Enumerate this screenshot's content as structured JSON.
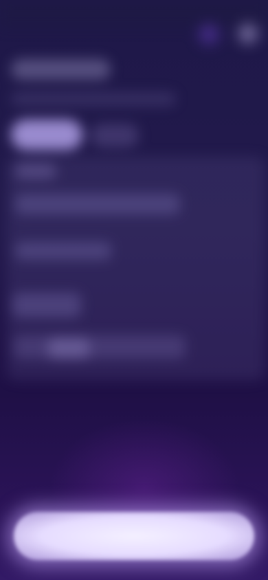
{
  "screen": {
    "theme_colors": {
      "background_top": "#1e1848",
      "background_bottom": "#331a66",
      "chip_active": "#b8a8f0",
      "cta_fill": "#f4f0ff"
    }
  },
  "header": {
    "title": "",
    "avatar_icon": "avatar-icon",
    "highlight_icon": "sparkle-icon"
  },
  "filters": {
    "active_chip_label": ""
  },
  "content": {
    "rows": [
      {
        "label": ""
      },
      {
        "label": ""
      },
      {
        "label": ""
      },
      {
        "label": ""
      },
      {
        "label": ""
      }
    ]
  },
  "footer": {
    "cta_label": ""
  }
}
